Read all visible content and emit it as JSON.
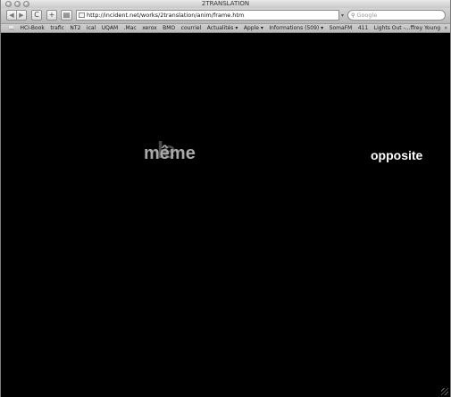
{
  "window": {
    "title": "2TRANSLATION"
  },
  "toolbar": {
    "back_glyph": "◀",
    "forward_glyph": "▶",
    "reload_glyph": "C",
    "add_glyph": "+",
    "print_glyph": "▤",
    "url": "http://incident.net/works/2translation/anim/frame.htm",
    "search_placeholder": "Google"
  },
  "bookmarks": {
    "book_glyph": "📖",
    "items": [
      "HCI-Book",
      "trafic",
      "NT2",
      "ical",
      "UQAM",
      ".Mac",
      "xerox",
      "BMO",
      "courriel",
      "Actualités ▾",
      "Apple ▾",
      "Informations (509) ▾",
      "SomaFM",
      "411",
      "Lights Out -...ffrey Young"
    ],
    "more_glyph": "»"
  },
  "content": {
    "background": "#000000",
    "ghost_word": "le",
    "main_word": "même",
    "right_word": "opposite"
  }
}
